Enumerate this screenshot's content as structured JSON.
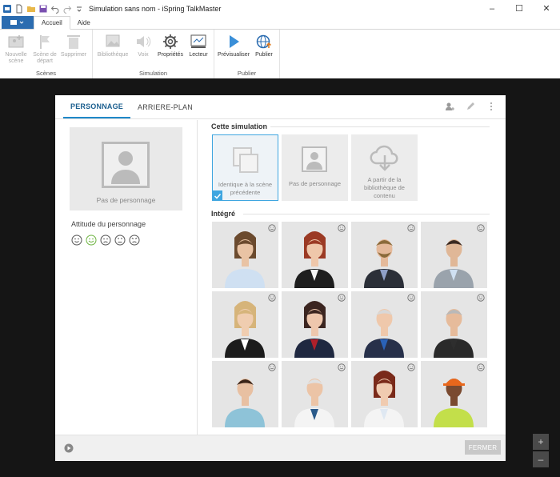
{
  "window": {
    "title": "Simulation sans nom - iSpring TalkMaster",
    "controls": {
      "minimize": "–",
      "maximize": "☐",
      "close": "✕"
    }
  },
  "ribbon": {
    "tabs": [
      "Accueil",
      "Aide"
    ],
    "groups": [
      {
        "label": "Scènes",
        "buttons": [
          {
            "label": "Nouvelle scène",
            "icon": "new-scene-icon"
          },
          {
            "label": "Scène de départ",
            "icon": "flag-icon"
          },
          {
            "label": "Supprimer",
            "icon": "trash-icon"
          }
        ]
      },
      {
        "label": "Simulation",
        "buttons": [
          {
            "label": "Bibliothèque",
            "icon": "library-icon"
          },
          {
            "label": "Voix",
            "icon": "speaker-icon"
          },
          {
            "label": "Propriétés",
            "icon": "gear-icon"
          },
          {
            "label": "Lecteur",
            "icon": "player-icon"
          }
        ]
      },
      {
        "label": "Publier",
        "buttons": [
          {
            "label": "Prévisualiser",
            "icon": "play-icon"
          },
          {
            "label": "Publier",
            "icon": "globe-icon"
          }
        ]
      }
    ]
  },
  "dialog": {
    "tabs": [
      "PERSONNAGE",
      "ARRIERE-PLAN"
    ],
    "left": {
      "placeholder_caption": "Pas de personnage",
      "attitude_label": "Attitude du personnage",
      "attitudes": [
        "neutral",
        "happy",
        "sad",
        "confused",
        "angry"
      ]
    },
    "right": {
      "section_simulation": "Cette simulation",
      "sim_cards": [
        {
          "caption": "Identique à la scène précédente",
          "selected": true
        },
        {
          "caption": "Pas de personnage",
          "selected": false
        },
        {
          "caption": "A partir de la bibliothèque de contenu",
          "selected": false
        }
      ],
      "section_integrated": "Intégré"
    },
    "close_label": "FERMER"
  },
  "zoom": {
    "in": "+",
    "out": "–"
  },
  "colors": {
    "accent": "#1e88c8",
    "file_button": "#2b6cb0",
    "workspace": "#151515"
  }
}
